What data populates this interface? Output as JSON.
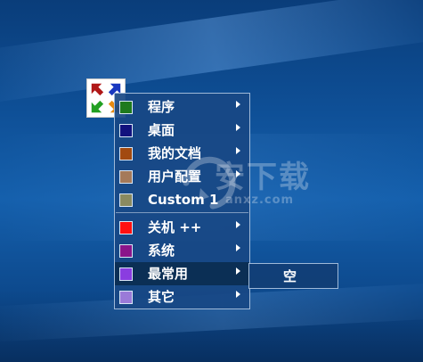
{
  "menu": {
    "items": [
      {
        "label": "程序",
        "color": "#1e7a1e",
        "has_submenu": true
      },
      {
        "label": "桌面",
        "color": "#12127e",
        "has_submenu": true
      },
      {
        "label": "我的文档",
        "color": "#a24a10",
        "has_submenu": true
      },
      {
        "label": "用户配置",
        "color": "#a57a5a",
        "has_submenu": true
      },
      {
        "label": "Custom 1",
        "color": "#8a8a60",
        "has_submenu": false
      },
      {
        "label": "关机 ++",
        "color": "#ff1010",
        "has_submenu": true
      },
      {
        "label": "系统",
        "color": "#8a158a",
        "has_submenu": true
      },
      {
        "label": "最常用",
        "color": "#8a3de0",
        "has_submenu": true,
        "selected": true
      },
      {
        "label": "其它",
        "color": "#9a7ad8",
        "has_submenu": true
      }
    ]
  },
  "submenu": {
    "items": [
      {
        "label": "空"
      }
    ]
  },
  "watermark": {
    "text": "安下载",
    "subtext": "anxz.com"
  }
}
